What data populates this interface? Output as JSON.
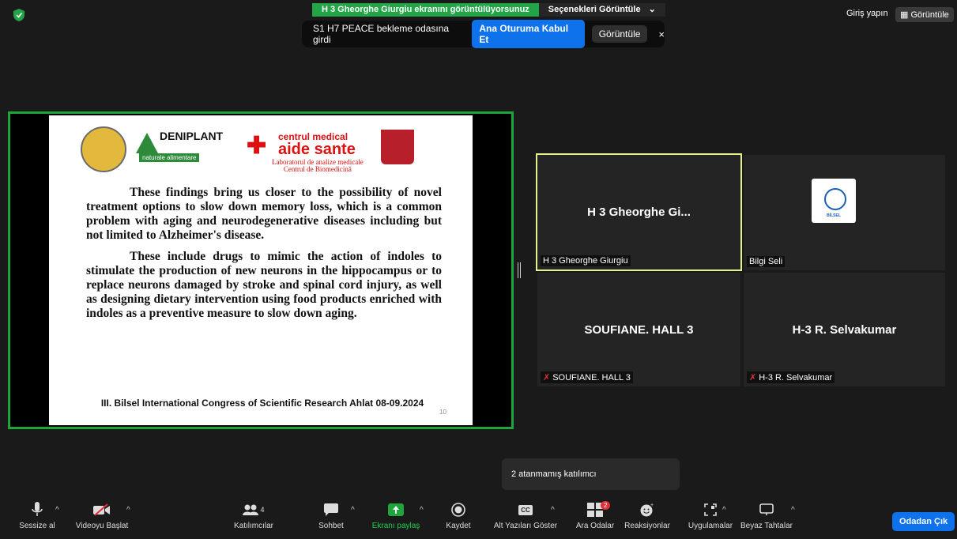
{
  "share_banner": {
    "status": "H 3 Gheorghe Giurgiu ekranını görüntülüyorsunuz",
    "options": "Seçenekleri Görüntüle",
    "options_caret": "⌄"
  },
  "notification": {
    "message": "S1 H7 PEACE bekleme odasına girdi",
    "admit_label": "Ana Oturuma Kabul Et",
    "view_label": "Görüntüle",
    "close_glyph": "×"
  },
  "top_right": {
    "signin_label": "Giriş yapın",
    "view_label": "Görüntüle"
  },
  "slide": {
    "logo_deniplant": "DENIPLANT",
    "logo_deniplant_sub": "naturale alimentare",
    "centrul_1": "centrul medical",
    "centrul_2": "aide sante",
    "centrul_3": "Laboratorul de analize medicale",
    "centrul_4": "Centrul de Biomedicină",
    "para1": "These findings bring us closer to the possibility of novel treatment options to slow down memory loss, which is a common problem with aging and neurodegenerative diseases including but not limited to Alzheimer's disease.",
    "para2": "These include drugs to mimic the action of indoles to stimulate the production of new neurons in the hippocampus or to replace neurons damaged by stroke and spinal cord injury, as well as designing dietary intervention using food products enriched with indoles as a preventive measure to slow down aging.",
    "footer": "III. Bilsel International Congress of Scientific Research Ahlat 08-09.2024",
    "page_number": "10"
  },
  "participants": [
    {
      "display": "H 3 Gheorghe Gi...",
      "label": "H 3 Gheorghe Giurgiu"
    },
    {
      "display": "",
      "label": "Bilgi Seli",
      "logo_text": "BİLSEL"
    },
    {
      "display": "SOUFIANE. HALL 3",
      "label": "SOUFIANE. HALL 3"
    },
    {
      "display": "H-3 R. Selvakumar",
      "label": "H-3 R. Selvakumar"
    }
  ],
  "tooltip": "2 atanmamış katılımcı",
  "toolbar": {
    "mute": "Sessize al",
    "video": "Videoyu Başlat",
    "participants": "Katılımcılar",
    "participants_count": "4",
    "chat": "Sohbet",
    "share": "Ekranı paylaş",
    "record": "Kaydet",
    "captions": "Alt Yazıları Göster",
    "captions_icon": "CC",
    "breakout": "Ara Odalar",
    "breakout_badge": "2",
    "reactions": "Reaksiyonlar",
    "apps": "Uygulamalar",
    "whiteboard": "Beyaz Tahtalar",
    "leave": "Odadan Çık"
  }
}
